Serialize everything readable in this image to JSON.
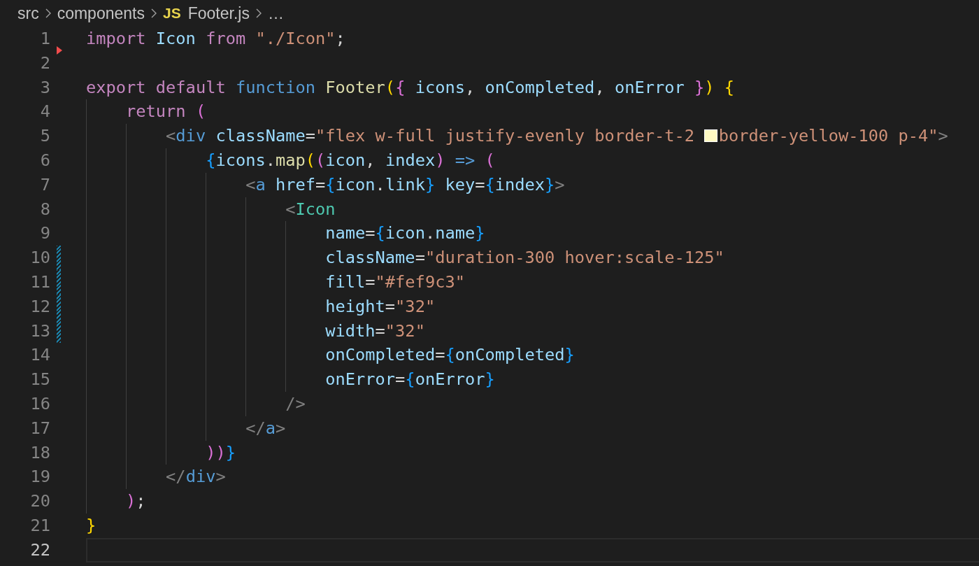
{
  "breadcrumb": [
    {
      "kind": "folder",
      "label": "src"
    },
    {
      "kind": "folder",
      "label": "components"
    },
    {
      "kind": "file",
      "badge": "JS",
      "label": "Footer.js"
    },
    {
      "kind": "more",
      "label": "…"
    }
  ],
  "lines": [
    {
      "number": "1",
      "deleted_below": true,
      "modified": false,
      "current": false,
      "tokens": [
        {
          "kind": "kw",
          "text": "import"
        },
        {
          "kind": "var",
          "text": " Icon"
        },
        {
          "kind": "kw",
          "text": " from"
        },
        {
          "kind": "str",
          "text": " \"./Icon\""
        },
        {
          "kind": "plain",
          "text": ";"
        }
      ]
    },
    {
      "number": "2",
      "deleted_below": false,
      "modified": false,
      "current": false
    },
    {
      "number": "3",
      "deleted_below": false,
      "modified": false,
      "current": false,
      "tokens": [
        {
          "kind": "kw",
          "text": "export"
        },
        {
          "kind": "kw",
          "text": " default"
        },
        {
          "kind": "storage",
          "text": " function"
        },
        {
          "kind": "fn",
          "text": " Footer"
        },
        {
          "kind": "b1",
          "text": "("
        },
        {
          "kind": "b2",
          "text": "{"
        },
        {
          "kind": "var",
          "text": " icons"
        },
        {
          "kind": "plain",
          "text": ","
        },
        {
          "kind": "var",
          "text": " onCompleted"
        },
        {
          "kind": "plain",
          "text": ","
        },
        {
          "kind": "var",
          "text": " onError"
        },
        {
          "kind": "b2",
          "text": " }"
        },
        {
          "kind": "b1",
          "text": ")"
        },
        {
          "kind": "b1",
          "text": " {"
        }
      ]
    },
    {
      "number": "4",
      "deleted_below": false,
      "modified": false,
      "current": false,
      "tokens": [
        {
          "kind": "kw",
          "text": "    return"
        },
        {
          "kind": "b2",
          "text": " ("
        }
      ]
    },
    {
      "number": "5",
      "deleted_below": false,
      "modified": false,
      "current": false,
      "tokens": [
        {
          "kind": "tagp",
          "text": "        <"
        },
        {
          "kind": "tag",
          "text": "div"
        },
        {
          "kind": "attr",
          "text": " className"
        },
        {
          "kind": "plain",
          "text": "="
        },
        {
          "kind": "str",
          "text": "\"flex w-full justify-evenly border-t-2 "
        },
        {
          "kind": "swatch",
          "color": "#fef9c3"
        },
        {
          "kind": "str",
          "text": "border-yellow-100 p-4\""
        },
        {
          "kind": "tagp",
          "text": ">"
        }
      ]
    },
    {
      "number": "6",
      "deleted_below": false,
      "modified": false,
      "current": false,
      "tokens": [
        {
          "kind": "b3",
          "text": "            {"
        },
        {
          "kind": "var",
          "text": "icons"
        },
        {
          "kind": "plain",
          "text": "."
        },
        {
          "kind": "fn",
          "text": "map"
        },
        {
          "kind": "b1",
          "text": "("
        },
        {
          "kind": "b2",
          "text": "("
        },
        {
          "kind": "var",
          "text": "icon"
        },
        {
          "kind": "plain",
          "text": ","
        },
        {
          "kind": "var",
          "text": " index"
        },
        {
          "kind": "b2",
          "text": ")"
        },
        {
          "kind": "storage",
          "text": " =>"
        },
        {
          "kind": "b2",
          "text": " ("
        }
      ]
    },
    {
      "number": "7",
      "deleted_below": false,
      "modified": false,
      "current": false,
      "tokens": [
        {
          "kind": "tagp",
          "text": "                <"
        },
        {
          "kind": "tag",
          "text": "a"
        },
        {
          "kind": "attr",
          "text": " href"
        },
        {
          "kind": "plain",
          "text": "="
        },
        {
          "kind": "b3",
          "text": "{"
        },
        {
          "kind": "var",
          "text": "icon"
        },
        {
          "kind": "plain",
          "text": "."
        },
        {
          "kind": "var",
          "text": "link"
        },
        {
          "kind": "b3",
          "text": "}"
        },
        {
          "kind": "attr",
          "text": " key"
        },
        {
          "kind": "plain",
          "text": "="
        },
        {
          "kind": "b3",
          "text": "{"
        },
        {
          "kind": "var",
          "text": "index"
        },
        {
          "kind": "b3",
          "text": "}"
        },
        {
          "kind": "tagp",
          "text": ">"
        }
      ]
    },
    {
      "number": "8",
      "deleted_below": false,
      "modified": false,
      "current": false,
      "tokens": [
        {
          "kind": "tagp",
          "text": "                    <"
        },
        {
          "kind": "comp",
          "text": "Icon"
        }
      ]
    },
    {
      "number": "9",
      "deleted_below": false,
      "modified": false,
      "current": false,
      "tokens": [
        {
          "kind": "attr",
          "text": "                        name"
        },
        {
          "kind": "plain",
          "text": "="
        },
        {
          "kind": "b3",
          "text": "{"
        },
        {
          "kind": "var",
          "text": "icon"
        },
        {
          "kind": "plain",
          "text": "."
        },
        {
          "kind": "var",
          "text": "name"
        },
        {
          "kind": "b3",
          "text": "}"
        }
      ]
    },
    {
      "number": "10",
      "deleted_below": false,
      "modified": true,
      "current": false,
      "tokens": [
        {
          "kind": "attr",
          "text": "                        className"
        },
        {
          "kind": "plain",
          "text": "="
        },
        {
          "kind": "str",
          "text": "\"duration-300 hover:scale-125\""
        }
      ]
    },
    {
      "number": "11",
      "deleted_below": false,
      "modified": true,
      "current": false,
      "tokens": [
        {
          "kind": "attr",
          "text": "                        fill"
        },
        {
          "kind": "plain",
          "text": "="
        },
        {
          "kind": "str",
          "text": "\"#fef9c3\""
        }
      ]
    },
    {
      "number": "12",
      "deleted_below": false,
      "modified": true,
      "current": false,
      "tokens": [
        {
          "kind": "attr",
          "text": "                        height"
        },
        {
          "kind": "plain",
          "text": "="
        },
        {
          "kind": "str",
          "text": "\"32\""
        }
      ]
    },
    {
      "number": "13",
      "deleted_below": false,
      "modified": true,
      "current": false,
      "tokens": [
        {
          "kind": "attr",
          "text": "                        width"
        },
        {
          "kind": "plain",
          "text": "="
        },
        {
          "kind": "str",
          "text": "\"32\""
        }
      ]
    },
    {
      "number": "14",
      "deleted_below": false,
      "modified": false,
      "current": false,
      "tokens": [
        {
          "kind": "attr",
          "text": "                        onCompleted"
        },
        {
          "kind": "plain",
          "text": "="
        },
        {
          "kind": "b3",
          "text": "{"
        },
        {
          "kind": "var",
          "text": "onCompleted"
        },
        {
          "kind": "b3",
          "text": "}"
        }
      ]
    },
    {
      "number": "15",
      "deleted_below": false,
      "modified": false,
      "current": false,
      "tokens": [
        {
          "kind": "attr",
          "text": "                        onError"
        },
        {
          "kind": "plain",
          "text": "="
        },
        {
          "kind": "b3",
          "text": "{"
        },
        {
          "kind": "var",
          "text": "onError"
        },
        {
          "kind": "b3",
          "text": "}"
        }
      ]
    },
    {
      "number": "16",
      "deleted_below": false,
      "modified": false,
      "current": false,
      "tokens": [
        {
          "kind": "tagp",
          "text": "                    />"
        }
      ]
    },
    {
      "number": "17",
      "deleted_below": false,
      "modified": false,
      "current": false,
      "tokens": [
        {
          "kind": "tagp",
          "text": "                </"
        },
        {
          "kind": "tag",
          "text": "a"
        },
        {
          "kind": "tagp",
          "text": ">"
        }
      ]
    },
    {
      "number": "18",
      "deleted_below": false,
      "modified": false,
      "current": false,
      "tokens": [
        {
          "kind": "b2",
          "text": "            )"
        },
        {
          "kind": "b2",
          "text": ")"
        },
        {
          "kind": "b3",
          "text": "}"
        }
      ]
    },
    {
      "number": "19",
      "deleted_below": false,
      "modified": false,
      "current": false,
      "tokens": [
        {
          "kind": "tagp",
          "text": "        </"
        },
        {
          "kind": "tag",
          "text": "div"
        },
        {
          "kind": "tagp",
          "text": ">"
        }
      ]
    },
    {
      "number": "20",
      "deleted_below": false,
      "modified": false,
      "current": false,
      "tokens": [
        {
          "kind": "b2",
          "text": "    )"
        },
        {
          "kind": "plain",
          "text": ";"
        }
      ]
    },
    {
      "number": "21",
      "deleted_below": false,
      "modified": false,
      "current": false,
      "tokens": [
        {
          "kind": "b1",
          "text": "}"
        }
      ]
    },
    {
      "number": "22",
      "deleted_below": false,
      "modified": false,
      "current": true
    }
  ]
}
